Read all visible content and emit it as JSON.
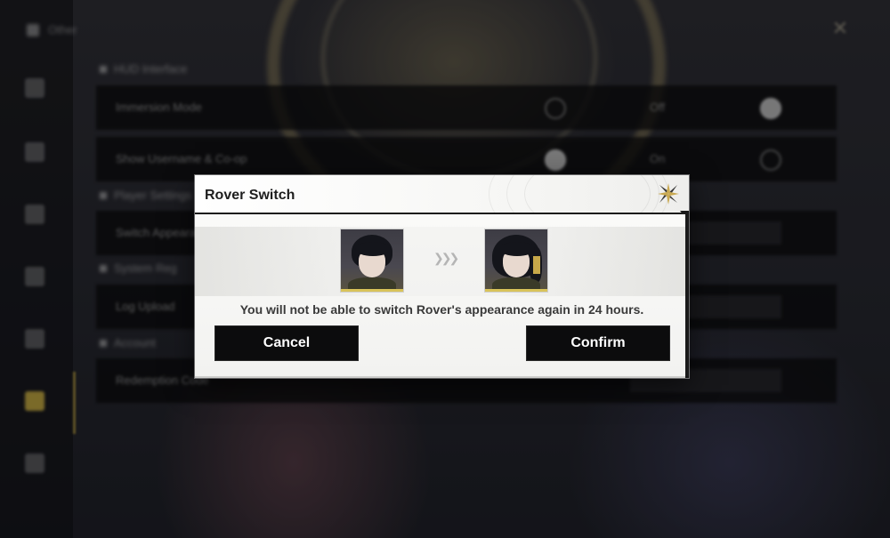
{
  "background": {
    "top_label": "Other",
    "sections": [
      "HUD Interface",
      "Player Settings",
      "System Reg",
      "Account"
    ],
    "rows": [
      {
        "label": "Immersion Mode",
        "value": "Off"
      },
      {
        "label": "Show Username & Co-op",
        "value": "On"
      },
      {
        "label": "Switch Appearance",
        "value": ""
      },
      {
        "label": "Log Upload",
        "value": ""
      },
      {
        "label": "Redemption Code",
        "value": ""
      }
    ]
  },
  "dialog": {
    "title": "Rover Switch",
    "close_icon": "close-x-icon",
    "from_portrait": "rover-male-portrait",
    "to_portrait": "rover-female-portrait",
    "arrows_icon": "triple-chevron-right-icon",
    "message": "You will not be able to switch Rover's appearance again in 24 hours.",
    "cancel_label": "Cancel",
    "confirm_label": "Confirm"
  },
  "colors": {
    "accent_gold": "#d9c35a",
    "button_bg": "#0c0c0d",
    "button_text": "#ffffff",
    "dialog_bg": "#f4f4f2"
  }
}
